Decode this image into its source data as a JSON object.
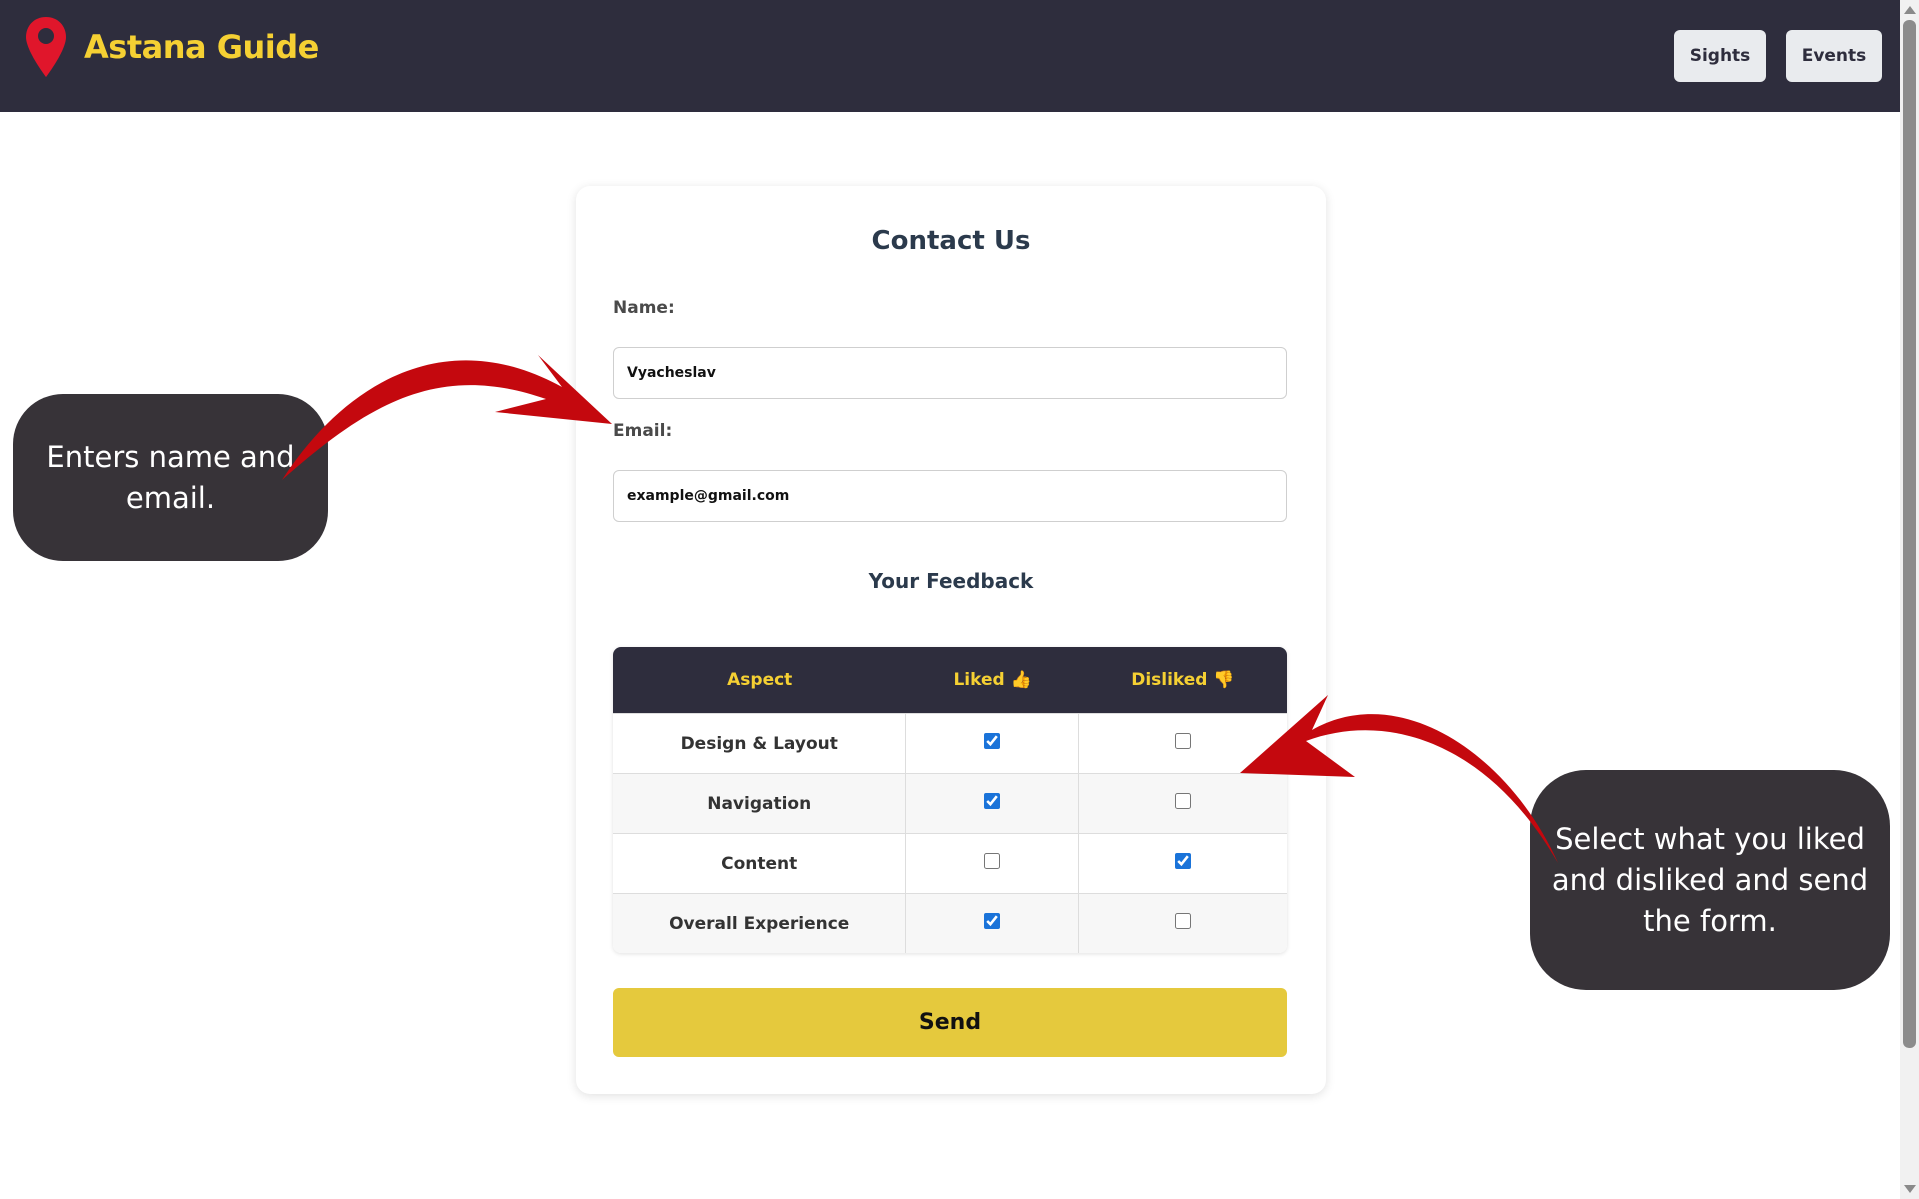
{
  "header": {
    "brand": "Astana Guide",
    "logo_icon": "map-pin-icon",
    "nav": [
      {
        "label": "Sights"
      },
      {
        "label": "Events"
      }
    ],
    "colors": {
      "background": "#2e2d3d",
      "brand": "#f5d033",
      "pin": "#e0162b"
    }
  },
  "form": {
    "title": "Contact Us",
    "name_label": "Name:",
    "name_value": "Vyacheslav",
    "email_label": "Email:",
    "email_value": "example@gmail.com",
    "feedback_title": "Your Feedback",
    "table": {
      "headers": {
        "aspect": "Aspect",
        "liked": "Liked 👍",
        "disliked": "Disliked 👎"
      },
      "rows": [
        {
          "aspect": "Design & Layout",
          "liked": true,
          "disliked": false
        },
        {
          "aspect": "Navigation",
          "liked": true,
          "disliked": false
        },
        {
          "aspect": "Content",
          "liked": false,
          "disliked": true
        },
        {
          "aspect": "Overall Experience",
          "liked": true,
          "disliked": false
        }
      ]
    },
    "send_label": "Send",
    "colors": {
      "send": "#e5c93d",
      "checkbox": "#1a73d9"
    }
  },
  "annotations": {
    "left": "Enters name and email.",
    "right": "Select what you liked and disliked and send the form.",
    "arrow_color": "#c4080e",
    "bubble_color": "#373338"
  }
}
